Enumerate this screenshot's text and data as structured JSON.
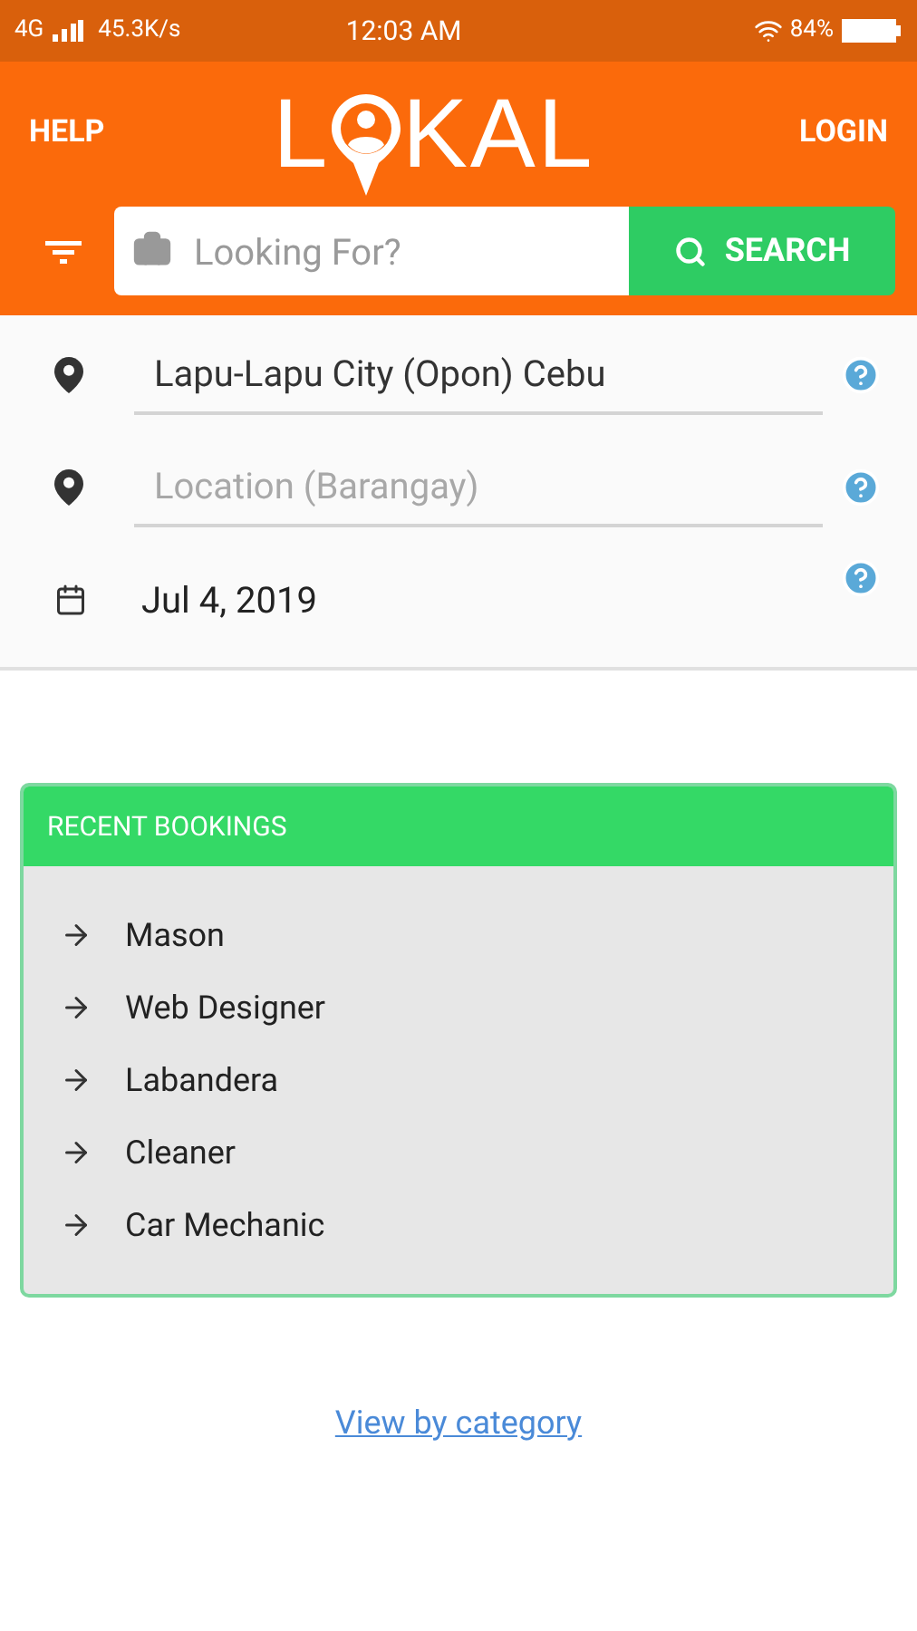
{
  "status_bar": {
    "network": "4G",
    "speed": "45.3K/s",
    "time": "12:03 AM",
    "battery": "84%"
  },
  "header": {
    "help": "HELP",
    "logo_start": "L",
    "logo_end": "KAL",
    "login": "LOGIN"
  },
  "search": {
    "placeholder": "Looking For?",
    "button": "SEARCH"
  },
  "fields": [
    {
      "kind": "location",
      "value": "Lapu-Lapu City (Opon) Cebu"
    },
    {
      "kind": "location",
      "placeholder": "Location (Barangay)"
    },
    {
      "kind": "date",
      "value": "Jul 4, 2019"
    }
  ],
  "recent_bookings": {
    "title": "RECENT BOOKINGS",
    "items": [
      "Mason",
      "Web Designer",
      "Labandera",
      "Cleaner",
      "Car Mechanic"
    ]
  },
  "link": "View by category"
}
